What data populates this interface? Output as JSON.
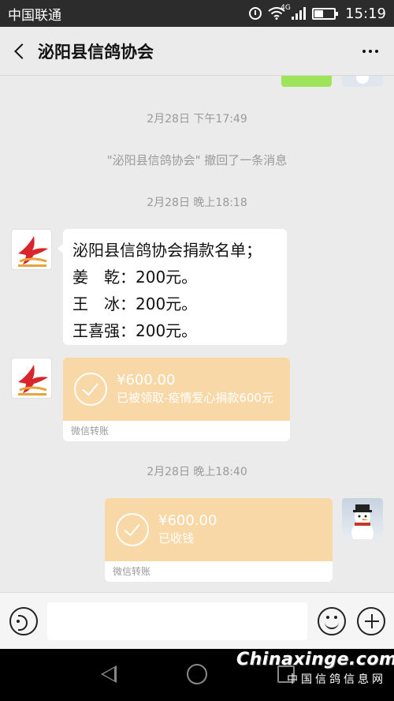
{
  "status_bar": {
    "carrier": "中国联通",
    "network": "4G",
    "time": "15:19"
  },
  "header": {
    "title": "泌阳县信鸽协会"
  },
  "messages": {
    "time1": "2月28日 下午17:49",
    "recall_notice": "\"泌阳县信鸽协会\" 撤回了一条消息",
    "time2": "2月28日 晚上18:18",
    "donation_lines": [
      "泌阳县信鸽协会捐款名单；",
      "姜　乾：200元。",
      "王　冰：200元。",
      "王喜强：200元。"
    ],
    "transfer1": {
      "amount": "¥600.00",
      "description": "已被领取-疫情爱心捐款600元",
      "label": "微信转账"
    },
    "time3": "2月28日 晚上18:40",
    "transfer2": {
      "amount": "¥600.00",
      "description": "已收钱",
      "label": "微信转账"
    }
  },
  "input_bar": {
    "placeholder": ""
  },
  "watermark": {
    "site": "Chinaxinge.com",
    "cn": "中国信鸽信息网"
  },
  "colors": {
    "transfer_top": "#f9d8a8",
    "transfer_body": "#fbe6c8",
    "sent_bubble_green": "#9ee45a",
    "avatar_red": "#d9262c"
  }
}
